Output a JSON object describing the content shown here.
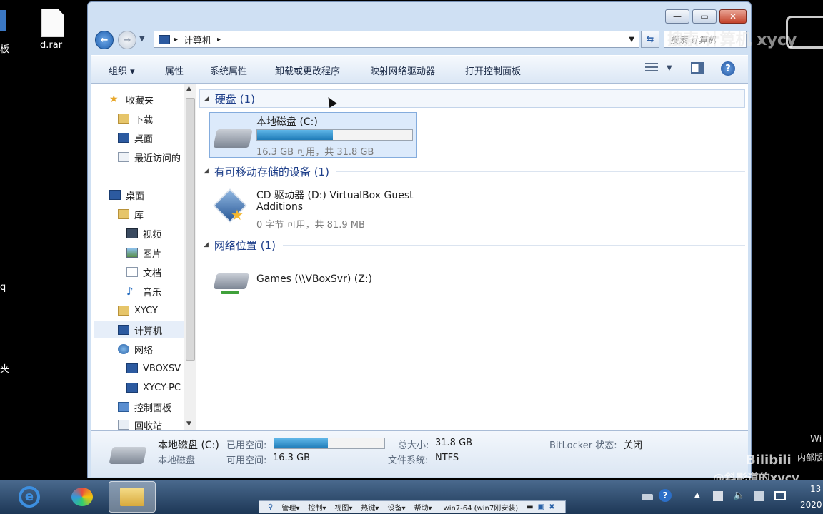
{
  "desktop": {
    "file_label": "d.rar",
    "edge_labels": [
      "板",
      "q",
      "夹"
    ],
    "watermark_search": "搜索 计算机 xycy",
    "watermark_right": "Wi",
    "watermark_right2": "内部版",
    "watermark_bilibili": "Bilibili",
    "watermark_user": "@斜影道的xycy",
    "clock_time": "13",
    "clock_year": "2020"
  },
  "window": {
    "address": {
      "sep": "▸",
      "path": "计算机",
      "arrow": "▸"
    },
    "search_placeholder": "搜索 计算机",
    "toolbar": {
      "organize": "组织 ▾",
      "properties": "属性",
      "system_properties": "系统属性",
      "uninstall": "卸载或更改程序",
      "map_drive": "映射网络驱动器",
      "control_panel": "打开控制面板"
    },
    "sidebar": [
      {
        "label": "收藏夹",
        "icon": "star-icon"
      },
      {
        "label": "下载",
        "icon": "download-folder-icon"
      },
      {
        "label": "桌面",
        "icon": "desktop-icon"
      },
      {
        "label": "最近访问的",
        "icon": "recent-places-icon"
      },
      {
        "label": "桌面",
        "icon": "desktop-icon"
      },
      {
        "label": "库",
        "icon": "library-icon"
      },
      {
        "label": "视频",
        "icon": "video-icon"
      },
      {
        "label": "图片",
        "icon": "picture-icon"
      },
      {
        "label": "文档",
        "icon": "document-icon"
      },
      {
        "label": "音乐",
        "icon": "music-icon"
      },
      {
        "label": "XYCY",
        "icon": "user-folder-icon"
      },
      {
        "label": "计算机",
        "icon": "computer-icon"
      },
      {
        "label": "网络",
        "icon": "network-icon"
      },
      {
        "label": "VBOXSV",
        "icon": "computer-icon"
      },
      {
        "label": "XYCY-PC",
        "icon": "computer-icon"
      },
      {
        "label": "控制面板",
        "icon": "control-panel-icon"
      },
      {
        "label": "回收站",
        "icon": "recycle-bin-icon"
      }
    ],
    "groups": {
      "hard_disks": "硬盘 (1)",
      "removable": "有可移动存储的设备 (1)",
      "network": "网络位置 (1)"
    },
    "drive_c": {
      "name": "本地磁盘 (C:)",
      "space": "16.3 GB 可用，共 31.8 GB",
      "used_fraction": 0.49
    },
    "drive_d": {
      "name_line1": "CD 驱动器 (D:) VirtualBox Guest",
      "name_line2": "Additions",
      "space": "0 字节 可用，共 81.9 MB"
    },
    "drive_z": {
      "name": "Games (\\\\VBoxSvr) (Z:)"
    },
    "details": {
      "name": "本地磁盘 (C:)",
      "type": "本地磁盘",
      "used_label": "已用空间:",
      "free_label": "可用空间:",
      "free_value": "16.3 GB",
      "total_label": "总大小:",
      "total_value": "31.8 GB",
      "fs_label": "文件系统:",
      "fs_value": "NTFS",
      "bitlocker_label": "BitLocker 状态:",
      "bitlocker_value": "关闭"
    }
  },
  "vbox_bar": {
    "items": [
      "管理▾",
      "控制▾",
      "视图▾",
      "热键▾",
      "设备▾",
      "帮助▾"
    ],
    "title": "win7-64 (win7刚安装)"
  },
  "colors": {
    "accent": "#1e3f8a",
    "usage_bar": "#2a8fc8",
    "taskbar": "#2c4a6e"
  }
}
